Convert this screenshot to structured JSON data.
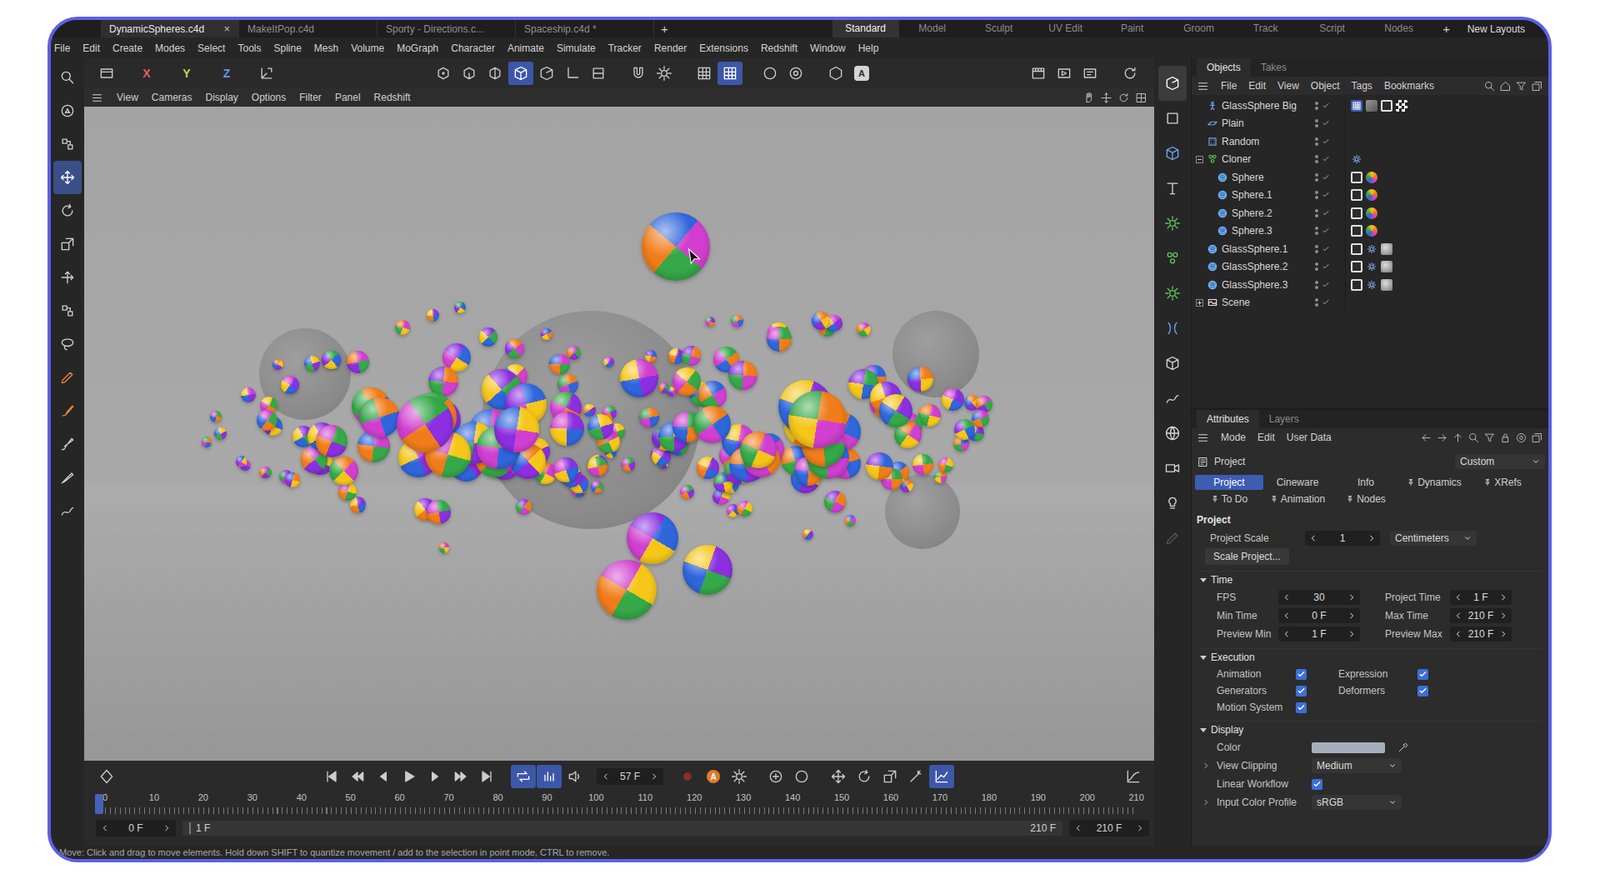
{
  "file_tabs": [
    {
      "label": "DynamicSpheres.c4d",
      "selected": true,
      "closable": true
    },
    {
      "label": "MakeItPop.c4d",
      "selected": false,
      "closable": false
    },
    {
      "label": "Sporty - Directions.c...",
      "selected": false,
      "closable": false
    },
    {
      "label": "Spaceship.c4d *",
      "selected": false,
      "closable": false
    }
  ],
  "close_glyph": "×",
  "new_tab": "+",
  "layouts": [
    {
      "label": "Standard",
      "selected": true
    },
    {
      "label": "Model",
      "selected": false
    },
    {
      "label": "Sculpt",
      "selected": false
    },
    {
      "label": "UV Edit",
      "selected": false
    },
    {
      "label": "Paint",
      "selected": false
    },
    {
      "label": "Groom",
      "selected": false
    },
    {
      "label": "Track",
      "selected": false
    },
    {
      "label": "Script",
      "selected": false
    },
    {
      "label": "Nodes",
      "selected": false
    }
  ],
  "new_layout": "+",
  "layouts_menu": "New Layouts",
  "menu": [
    "File",
    "Edit",
    "Create",
    "Modes",
    "Select",
    "Tools",
    "Spline",
    "Mesh",
    "Volume",
    "MoGraph",
    "Character",
    "Animate",
    "Simulate",
    "Tracker",
    "Render",
    "Extensions",
    "Redshift",
    "Window",
    "Help"
  ],
  "axes": [
    {
      "label": "X",
      "color": "#e0605a"
    },
    {
      "label": "Y",
      "color": "#c9d24a"
    },
    {
      "label": "Z",
      "color": "#6a95e6"
    }
  ],
  "toolbar_badge": "A",
  "tool_states": [
    false,
    false,
    false,
    true,
    false,
    false,
    false,
    false,
    false,
    false,
    false,
    false,
    false,
    false
  ],
  "toolbar_states": [
    false,
    false,
    false,
    true,
    false,
    false,
    false,
    false,
    false,
    false,
    true,
    false,
    false,
    false,
    false,
    false,
    false,
    false,
    false
  ],
  "manager_states": [
    true,
    false,
    false,
    false,
    false,
    false,
    false,
    false,
    false,
    false,
    false,
    false,
    false,
    false
  ],
  "viewport_menu": [
    "View",
    "Cameras",
    "Display",
    "Options",
    "Filter",
    "Panel",
    "Redshift"
  ],
  "objects": {
    "tabs": [
      {
        "label": "Objects",
        "selected": true
      },
      {
        "label": "Takes",
        "selected": false
      }
    ],
    "menu": [
      "File",
      "Edit",
      "View",
      "Object",
      "Tags",
      "Bookmarks"
    ],
    "items": [
      {
        "name": "GlassSphere Big",
        "depth": 0,
        "kind": "nullobj",
        "has_children": false,
        "expanded": false,
        "tags": [
          "compositing",
          "texture",
          "phong",
          "checker"
        ]
      },
      {
        "name": "Plain",
        "depth": 0,
        "kind": "plane",
        "has_children": false,
        "expanded": false,
        "tags": []
      },
      {
        "name": "Random",
        "depth": 0,
        "kind": "random",
        "has_children": false,
        "expanded": false,
        "tags": []
      },
      {
        "name": "Cloner",
        "depth": 0,
        "kind": "cloner",
        "has_children": true,
        "expanded": true,
        "tags": [
          "dynamics"
        ]
      },
      {
        "name": "Sphere",
        "depth": 1,
        "kind": "sphere",
        "has_children": false,
        "expanded": false,
        "tags": [
          "phong",
          "rainbow"
        ]
      },
      {
        "name": "Sphere.1",
        "depth": 1,
        "kind": "sphere",
        "has_children": false,
        "expanded": false,
        "tags": [
          "phong",
          "rainbow"
        ]
      },
      {
        "name": "Sphere.2",
        "depth": 1,
        "kind": "sphere",
        "has_children": false,
        "expanded": false,
        "tags": [
          "phong",
          "rainbow"
        ]
      },
      {
        "name": "Sphere.3",
        "depth": 1,
        "kind": "sphere",
        "has_children": false,
        "expanded": false,
        "tags": [
          "phong",
          "rainbow"
        ]
      },
      {
        "name": "GlassSphere.1",
        "depth": 0,
        "kind": "sphere",
        "has_children": false,
        "expanded": false,
        "tags": [
          "phong",
          "dynamics",
          "glass"
        ]
      },
      {
        "name": "GlassSphere.2",
        "depth": 0,
        "kind": "sphere",
        "has_children": false,
        "expanded": false,
        "tags": [
          "phong",
          "dynamics",
          "glass"
        ]
      },
      {
        "name": "GlassSphere.3",
        "depth": 0,
        "kind": "sphere",
        "has_children": false,
        "expanded": false,
        "tags": [
          "phong",
          "dynamics",
          "glass"
        ]
      },
      {
        "name": "Scene",
        "depth": 0,
        "kind": "scene",
        "has_children": true,
        "expanded": false,
        "tags": []
      }
    ]
  },
  "attributes": {
    "tabs": [
      {
        "label": "Attributes",
        "selected": true
      },
      {
        "label": "Layers",
        "selected": false
      }
    ],
    "menu": [
      "Mode",
      "Edit",
      "User Data"
    ],
    "title": "Project",
    "mode": "Custom",
    "subtabs": [
      {
        "label": "Project",
        "selected": true,
        "pinned": false
      },
      {
        "label": "Cineware",
        "selected": false,
        "pinned": false
      },
      {
        "label": "Info",
        "selected": false,
        "pinned": false
      },
      {
        "label": "Dynamics",
        "selected": false,
        "pinned": true
      },
      {
        "label": "XRefs",
        "selected": false,
        "pinned": true
      },
      {
        "label": "To Do",
        "selected": false,
        "pinned": true
      },
      {
        "label": "Animation",
        "selected": false,
        "pinned": true
      },
      {
        "label": "Nodes",
        "selected": false,
        "pinned": true
      }
    ],
    "section": "Project",
    "scale": {
      "label": "Project Scale",
      "value": "1",
      "unit": "Centimeters"
    },
    "scale_button": "Scale Project...",
    "groups": [
      {
        "title": "Time",
        "expanded": true,
        "kind": "pairs",
        "fields": [
          {
            "label": "FPS",
            "value": "30"
          },
          {
            "label": "Project Time",
            "value": "1 F"
          },
          {
            "label": "Min Time",
            "value": "0 F"
          },
          {
            "label": "Max Time",
            "value": "210 F"
          },
          {
            "label": "Preview Min",
            "value": "1 F"
          },
          {
            "label": "Preview Max",
            "value": "210 F"
          }
        ]
      },
      {
        "title": "Execution",
        "expanded": true,
        "kind": "checks",
        "fields": [
          {
            "label": "Animation",
            "checked": true
          },
          {
            "label": "Expression",
            "checked": true
          },
          {
            "label": "Generators",
            "checked": true
          },
          {
            "label": "Deformers",
            "checked": true
          },
          {
            "label": "Motion System",
            "checked": true
          }
        ]
      },
      {
        "title": "Display",
        "expanded": true,
        "kind": "rows",
        "fields": [
          {
            "label": "Color",
            "kind": "color",
            "value": "#a7aebb",
            "expandable": false
          },
          {
            "label": "View Clipping",
            "kind": "dropdown",
            "value": "Medium",
            "expandable": true
          },
          {
            "label": "Linear Workflow",
            "kind": "checkbox",
            "checked": true,
            "expandable": false
          },
          {
            "label": "Input Color Profile",
            "kind": "dropdown",
            "value": "sRGB",
            "expandable": true
          }
        ]
      }
    ]
  },
  "timeline": {
    "frame": "57 F",
    "autokey": "A",
    "states": [
      false,
      false,
      false,
      false,
      false,
      false,
      false,
      false,
      true,
      true,
      false,
      false,
      false,
      false,
      false,
      false,
      false,
      false,
      false,
      false,
      true,
      false
    ],
    "ruler": [
      "0",
      "10",
      "20",
      "30",
      "40",
      "50",
      "60",
      "70",
      "80",
      "90",
      "100",
      "110",
      "120",
      "130",
      "140",
      "150",
      "160",
      "170",
      "180",
      "190",
      "200",
      "210"
    ],
    "playhead": 0,
    "min": "0 F",
    "preview_start": "1 F",
    "preview_end": "210 F",
    "max": "210 F"
  },
  "status_bar": "Move: Click and drag to move elements. Hold down SHIFT to quantize movement / add to the selection in point mode, CTRL to remove."
}
